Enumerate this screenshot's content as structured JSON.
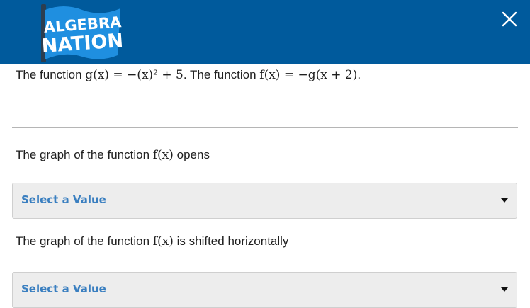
{
  "header": {
    "brand": "ALGEBRA NATION",
    "brand_line1": "ALGEBRA",
    "brand_line2": "NATION",
    "close_icon": "close-x-icon",
    "background_color": "#005a9c"
  },
  "problem": {
    "prefix": "The function ",
    "g_lhs": "g(x)",
    "g_rhs": " = −(x)² + 5",
    "middle": ". The function ",
    "f_lhs": "f(x)",
    "f_rhs": " = −g(x + 2)",
    "suffix": "."
  },
  "questions": [
    {
      "before": "The graph of the function ",
      "math": "f(x)",
      "after": " opens",
      "select": {
        "selected": "Select a Value"
      }
    },
    {
      "before": "The graph of the function ",
      "math": "f(x)",
      "after": " is shifted horizontally",
      "select": {
        "selected": "Select a Value"
      }
    }
  ],
  "colors": {
    "select_text": "#3a7fc0",
    "select_bg": "#ededed"
  }
}
